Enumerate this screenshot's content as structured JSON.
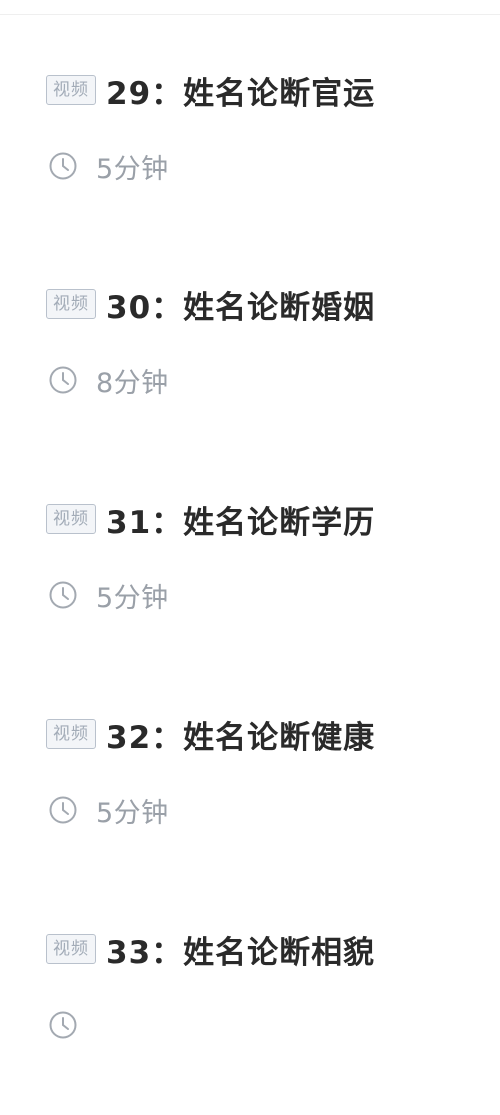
{
  "lessons": [
    {
      "badge": "视频",
      "title": "29：姓名论断官运",
      "duration": "5分钟",
      "icon": "clock-icon"
    },
    {
      "badge": "视频",
      "title": "30：姓名论断婚姻",
      "duration": "8分钟",
      "icon": "clock-icon"
    },
    {
      "badge": "视频",
      "title": "31：姓名论断学历",
      "duration": "5分钟",
      "icon": "clock-icon"
    },
    {
      "badge": "视频",
      "title": "32：姓名论断健康",
      "duration": "5分钟",
      "icon": "clock-icon"
    },
    {
      "badge": "视频",
      "title": "33：姓名论断相貌",
      "duration": "",
      "icon": "clock-icon"
    }
  ],
  "colors": {
    "title": "#2a2a2a",
    "badge_border": "#b9c1cc",
    "badge_text": "#a3acb8",
    "meta": "#9aa0a8"
  }
}
